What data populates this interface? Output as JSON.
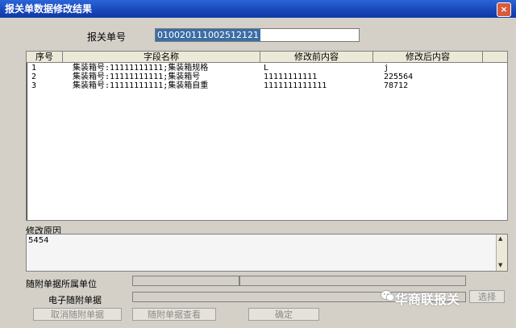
{
  "window": {
    "title": "报关单数据修改结果",
    "close": "×"
  },
  "bill": {
    "label": "报关单号",
    "value": "010020111002512121"
  },
  "table": {
    "headers": [
      "序号",
      "字段名称",
      "修改前内容",
      "修改后内容"
    ],
    "rows": [
      [
        "1",
        "集装箱号:11111111111;集装箱规格",
        "L",
        "j"
      ],
      [
        "2",
        "集装箱号:11111111111;集装箱号",
        "11111111111",
        "225564"
      ],
      [
        "3",
        "集装箱号:11111111111;集装箱自重",
        "1111111111111",
        "78712"
      ]
    ]
  },
  "reason": {
    "label": "修改原因",
    "value": "5454"
  },
  "attach": {
    "unit_label": "随附单据所属单位",
    "edoc_label": "电子随附单据",
    "select_label": "选择"
  },
  "buttons": {
    "cancel": "取消随附单据",
    "view": "随附单据查看",
    "confirm": "确定"
  },
  "watermark": "华商联报关",
  "colors": {
    "title_bar": "#1847b8",
    "window_bg": "#d4d0c8",
    "selection": "#3a6ea5"
  }
}
